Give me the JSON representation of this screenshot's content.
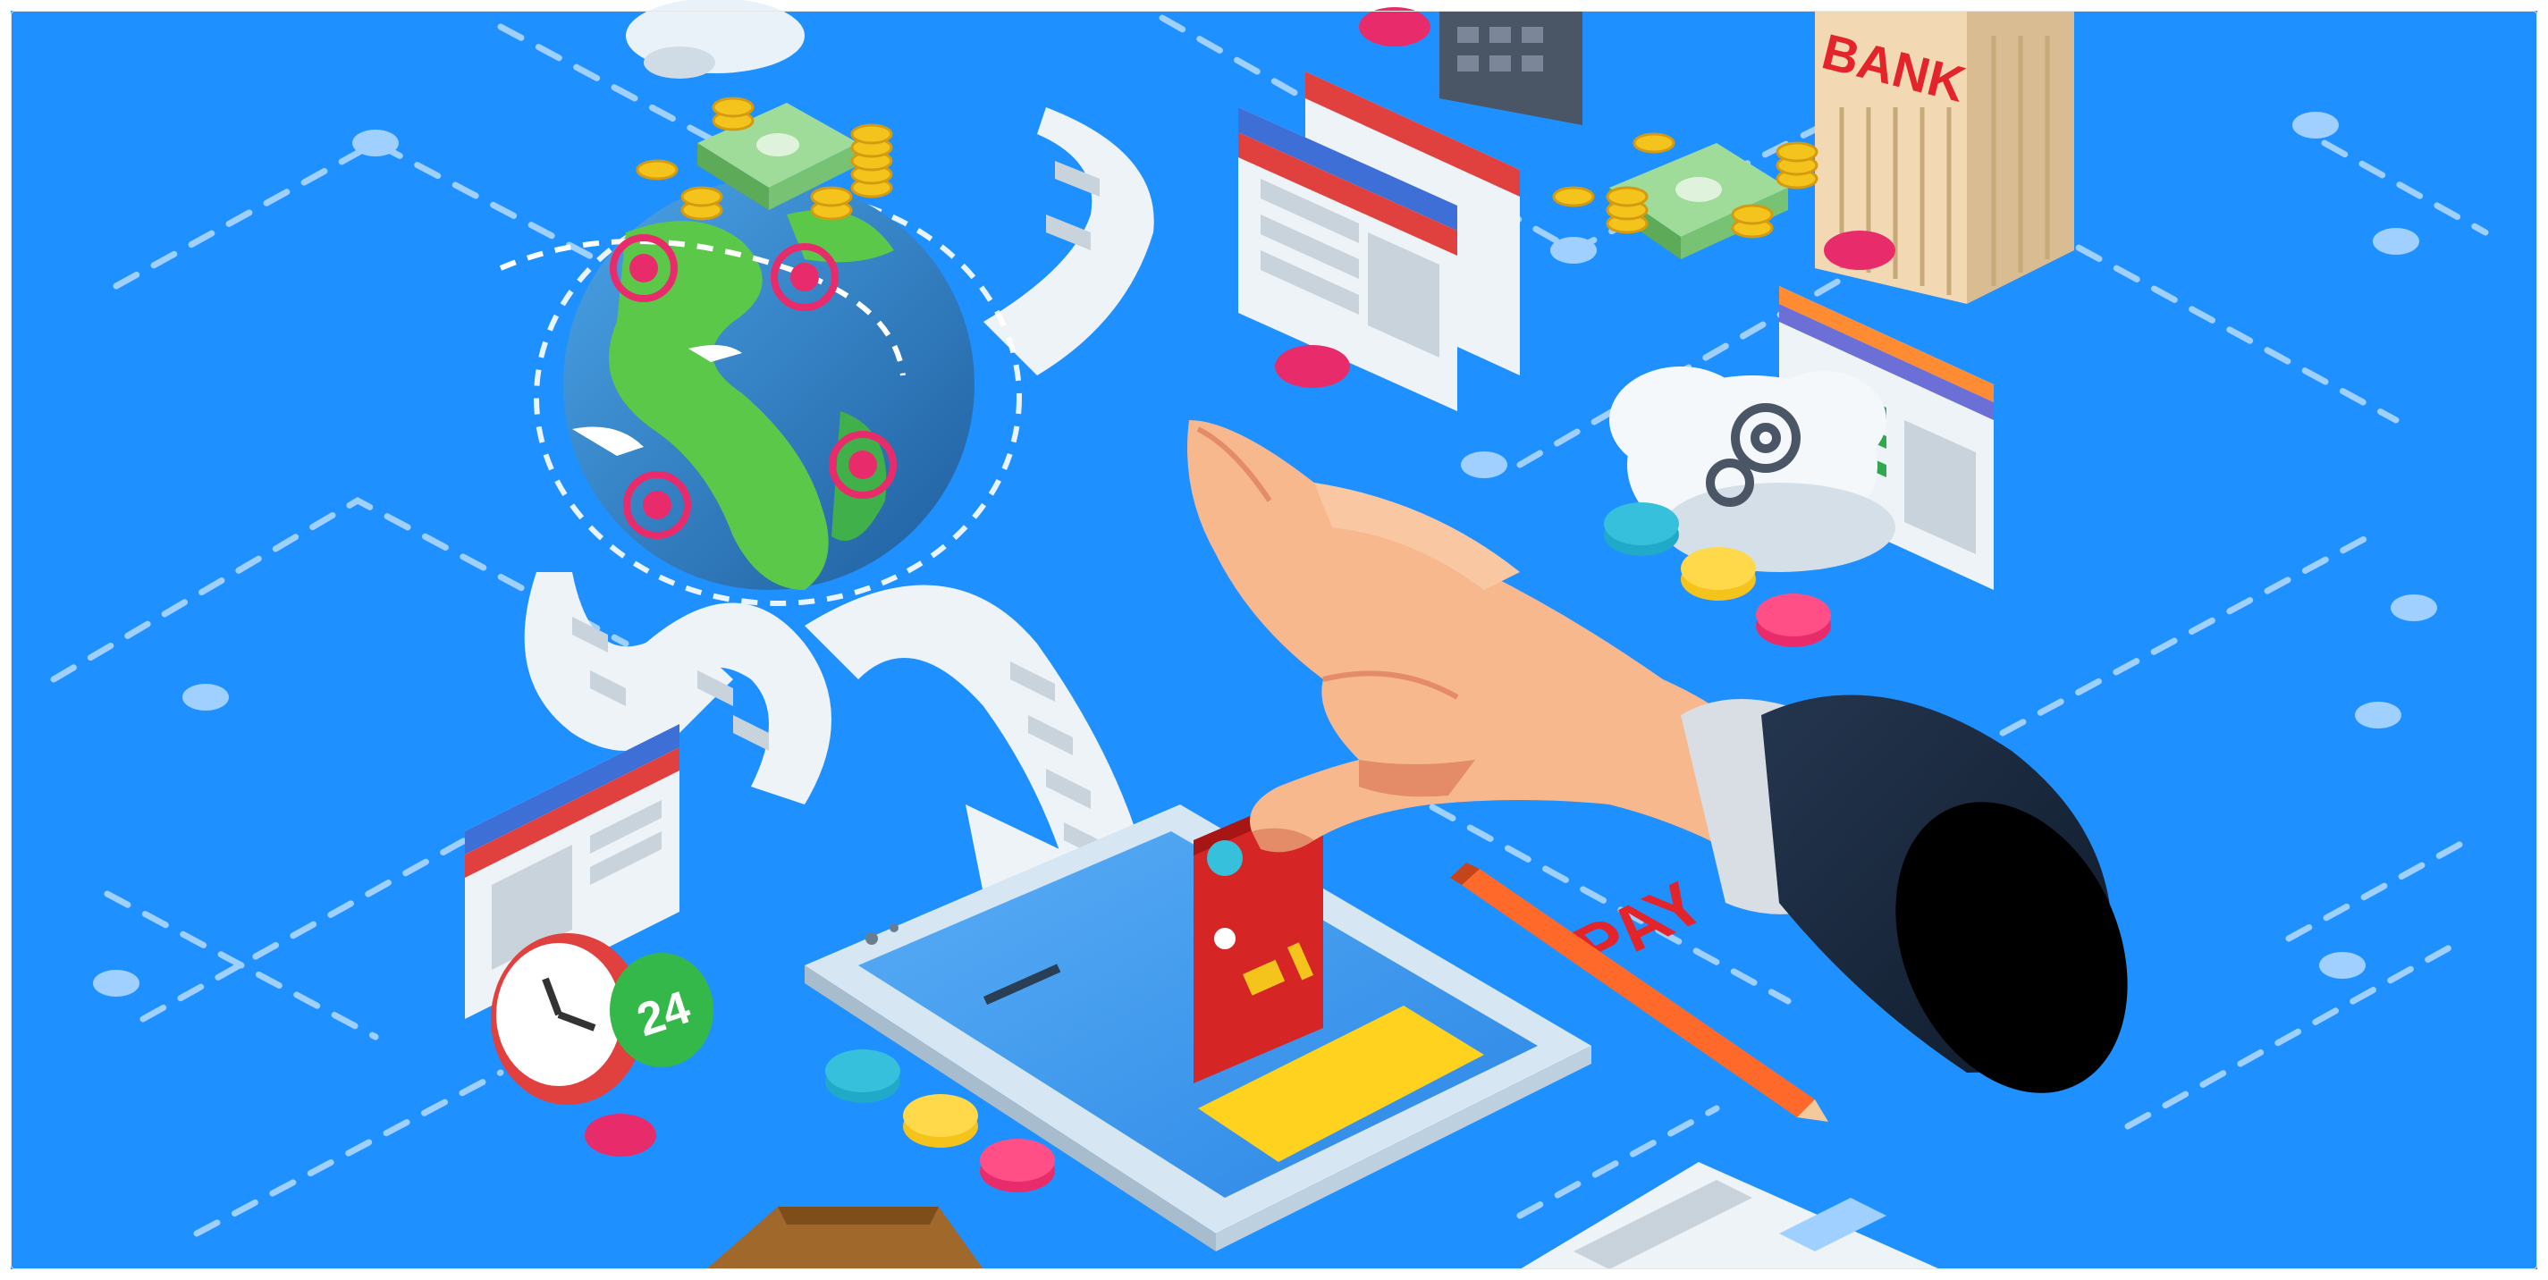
{
  "scene": {
    "description_free": true,
    "signage": {
      "bank_label": "BANK",
      "pay_label": "PAY",
      "clock_badge": "24"
    },
    "palette": {
      "background": "#1e90ff",
      "dash": "#9fd0ff",
      "globe_water": "#2f7ebf",
      "globe_land": "#5cc84a",
      "paper": "#eef3f7",
      "paper_shade": "#c9d3db",
      "coin": "#f5c41c",
      "coin_shade": "#d49b10",
      "cash": "#8ed18a",
      "card": "#d52525",
      "pay_yellow": "#ffd21f",
      "pay_text": "#e3242b",
      "skin": "#f7b88e",
      "skin_shade": "#e38c67",
      "sleeve": "#1b2a40",
      "cuff": "#d8dee3",
      "pencil": "#ff6a2a",
      "bank_tower": "#f2d9b3",
      "bank_text": "#e3242b",
      "pink_dot": "#e82c6b",
      "teal_dot": "#20a9c9",
      "gold_dot": "#f5c41c"
    },
    "icons": [
      "globe-icon",
      "receipt-icon",
      "credit-card-icon",
      "smartphone-icon",
      "hand-icon",
      "bank-building-icon",
      "cloud-gear-icon",
      "clock-icon",
      "pencil-icon",
      "coin-stack-icon",
      "banknote-icon",
      "browser-window-icon",
      "wallet-icon"
    ]
  }
}
